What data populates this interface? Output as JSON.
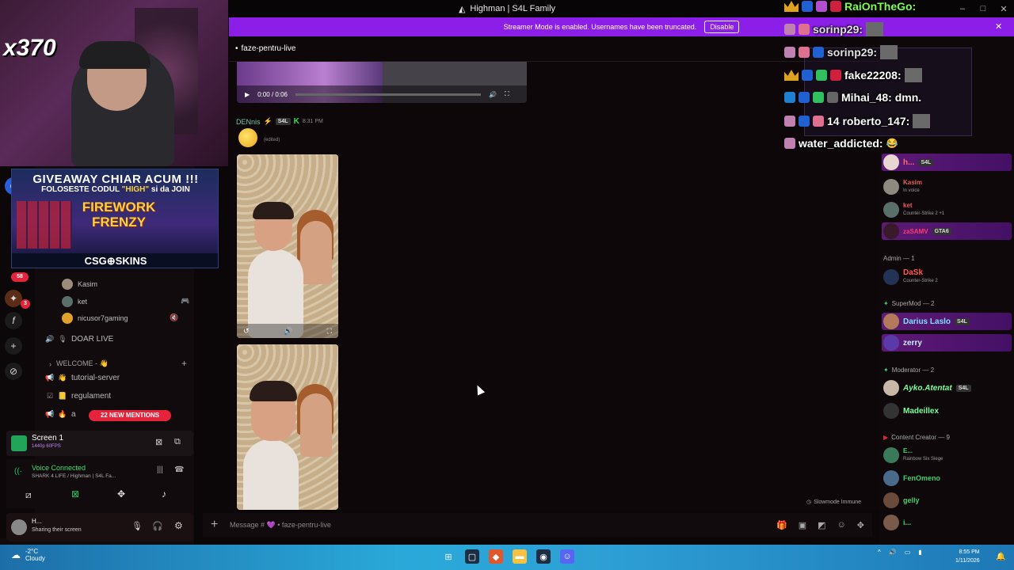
{
  "window": {
    "title": "Highman | S4L Family",
    "controls": [
      "–",
      "□",
      "✕"
    ]
  },
  "webcam": {
    "count": "x370"
  },
  "promo": {
    "line1": "GIVEAWAY CHIAR ACUM !!!",
    "line2_pre": "FOLOSESTE CODUL ",
    "line2_code": "\"HIGH\"",
    "line2_post": " si da JOIN",
    "firework": "FIREWORK FRENZY",
    "footer": "CSG⊕SKINS"
  },
  "sidebar": {
    "voice_members": [
      {
        "name": "Kasim",
        "color": "#9b8d7a"
      },
      {
        "name": "ket",
        "color": "#5a6f6a"
      },
      {
        "name": "nicusor7gaming",
        "color": "#e0a12c"
      }
    ],
    "channels": [
      {
        "icon": "🔊",
        "name": "DOAR LIVE"
      },
      {
        "icon": "#",
        "name": "WELCOME - 👋"
      },
      {
        "icon": "👋",
        "name": "tutorial-server"
      },
      {
        "icon": "📒",
        "name": "regulament"
      },
      {
        "icon": "🎁",
        "name": "a"
      }
    ],
    "mentions_badge": "22 NEW MENTIONS",
    "server_badges": [
      "58",
      "3"
    ]
  },
  "screen_panel": {
    "title": "Screen 1",
    "quality": "1440p 60FPS"
  },
  "voice": {
    "status": "Voice Connected",
    "channel": "SHARK 4 LIFE / Highman | S4L Fa..."
  },
  "user": {
    "name": "H...",
    "status": "Sharing their screen"
  },
  "banner": {
    "text": "Streamer Mode is enabled. Usernames have been truncated.",
    "button": "Disable"
  },
  "channel": {
    "name": "faze-pentru-live"
  },
  "video": {
    "time": "0:00 / 0:06"
  },
  "message": {
    "author": "DENnis",
    "tag": "S4L",
    "badge": "K",
    "time": "8:31 PM",
    "edited": "(edited)"
  },
  "slowmode": "Slowmode Immune",
  "composer": {
    "placeholder": "Message # 💜 • faze-pentru-live"
  },
  "member_list": {
    "top": [
      {
        "name": "h...",
        "tag": "S4L",
        "color": "#ff6b6b",
        "sub": "",
        "hl": true
      },
      {
        "name": "Kasim",
        "tag": "",
        "color": "#e85d5d",
        "sub": "In voice",
        "hl": false
      },
      {
        "name": "ket",
        "tag": "",
        "color": "#e85d5d",
        "sub": "Counter-Strike 2 +1",
        "hl": false
      },
      {
        "name": "zaSAMV",
        "tag": "GTA6",
        "color": "#ff3b6b",
        "sub": "",
        "hl": true
      }
    ],
    "categories": [
      {
        "label": "Admin — 1"
      },
      {
        "label": "SuperMod — 2"
      },
      {
        "label": "Moderator — 2"
      },
      {
        "label": "Content Creator — 9"
      }
    ],
    "admin": [
      {
        "name": "DaSk",
        "color": "#ff5a4e",
        "sub": "Counter-Strike 2",
        "tag": "",
        "hl": false
      }
    ],
    "supermod": [
      {
        "name": "Darius Laslo",
        "color": "#7ce0ff",
        "sub": "",
        "tag": "S4L",
        "hl": true
      },
      {
        "name": "zerry",
        "color": "#c8f0ff",
        "sub": "",
        "tag": "",
        "hl": true
      }
    ],
    "moderator": [
      {
        "name": "Ayko.Atentat",
        "color": "#7cff9a",
        "sub": "",
        "tag": "S4L",
        "hl": false
      },
      {
        "name": "Madeillex",
        "color": "#7cff9a",
        "sub": "",
        "tag": "",
        "hl": false
      }
    ],
    "creators": [
      {
        "name": "E...",
        "color": "#3fd06b",
        "sub": "Rainbow Six Siege",
        "tag": "",
        "hl": false
      },
      {
        "name": "FenOmeno",
        "color": "#3fd06b",
        "sub": "",
        "tag": "",
        "hl": false
      },
      {
        "name": "gelly",
        "color": "#3fd06b",
        "sub": "",
        "tag": "",
        "hl": false
      },
      {
        "name": "i...",
        "color": "#3fd06b",
        "sub": "",
        "tag": "",
        "hl": false
      }
    ]
  },
  "stream_overlay": {
    "lines": [
      {
        "text": "RaiOnTheGo:",
        "color": "#7cff4a"
      },
      {
        "text": "sorinp29:",
        "color": "#e0e0e0"
      },
      {
        "text": "sorinp29:",
        "color": "#e0e0e0"
      },
      {
        "text": "fake22208:",
        "color": "#ffffff"
      },
      {
        "text": "Mihai_48: dmn.",
        "color": "#ffffff"
      },
      {
        "text": "14 roberto_147:",
        "color": "#ffffff"
      },
      {
        "text": "water_addicted:",
        "color": "#ffffff"
      }
    ]
  },
  "taskbar": {
    "weather_temp": "-2°C",
    "weather_desc": "Cloudy",
    "time": "8:55 PM",
    "date": "1/11/2026"
  }
}
